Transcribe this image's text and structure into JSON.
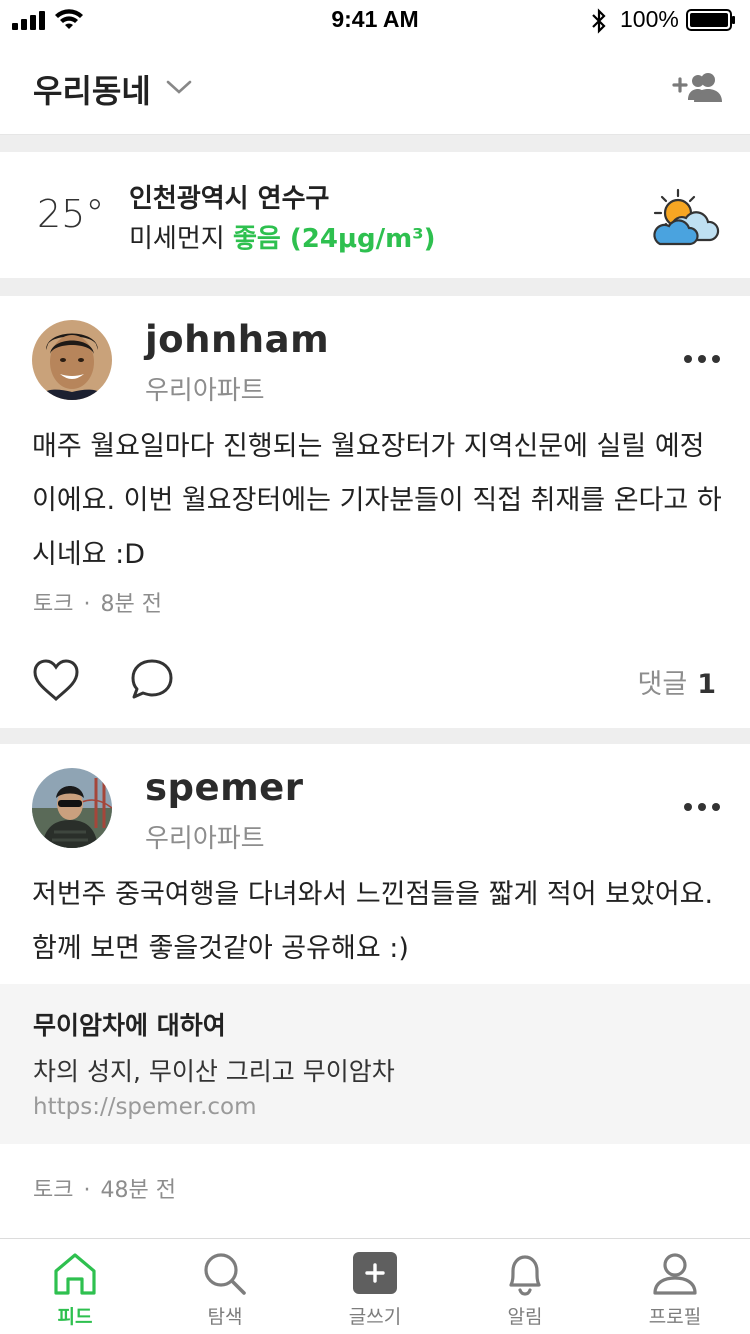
{
  "status_bar": {
    "time": "9:41 AM",
    "battery": "100%",
    "icons": [
      "signal-icon",
      "wifi-icon",
      "bluetooth-icon",
      "battery-icon"
    ]
  },
  "header": {
    "title": "우리동네",
    "icons": [
      "chevron-down-icon",
      "add-friend-icon"
    ]
  },
  "weather": {
    "temperature": "25°",
    "location": "인천광역시 연수구",
    "dust_label": "미세먼지",
    "dust_status": "좋음 (24μg/m³)",
    "icon": "partly-cloudy-icon",
    "good_color": "#2ec04f"
  },
  "posts": [
    {
      "username": "johnham",
      "apartment": "우리아파트",
      "body": "매주 월요일마다 진행되는 월요장터가 지역신문에 실릴 예정이에요. 이번 월요장터에는 기자분들이 직접 취재를 온다고 하시네요 :D",
      "category": "토크",
      "dot": "·",
      "time": "8분 전",
      "comment_label": "댓글",
      "comment_count": "1"
    },
    {
      "username": "spemer",
      "apartment": "우리아파트",
      "body": "저번주 중국여행을 다녀와서 느낀점들을 짧게 적어 보았어요. 함께 보면 좋을것같아 공유해요 :)",
      "link": {
        "title": "무이암차에 대하여",
        "description": "차의 성지, 무이산 그리고 무이암차",
        "url": "https://spemer.com"
      },
      "category": "토크",
      "dot": "·",
      "time": "48분 전"
    }
  ],
  "tabbar": {
    "accent": "#2ec04f",
    "tabs": [
      {
        "label": "피드",
        "icon": "home-icon",
        "active": true
      },
      {
        "label": "탐색",
        "icon": "search-icon",
        "active": false
      },
      {
        "label": "글쓰기",
        "icon": "write-plus-icon",
        "active": false
      },
      {
        "label": "알림",
        "icon": "bell-icon",
        "active": false
      },
      {
        "label": "프로필",
        "icon": "profile-icon",
        "active": false
      }
    ]
  }
}
